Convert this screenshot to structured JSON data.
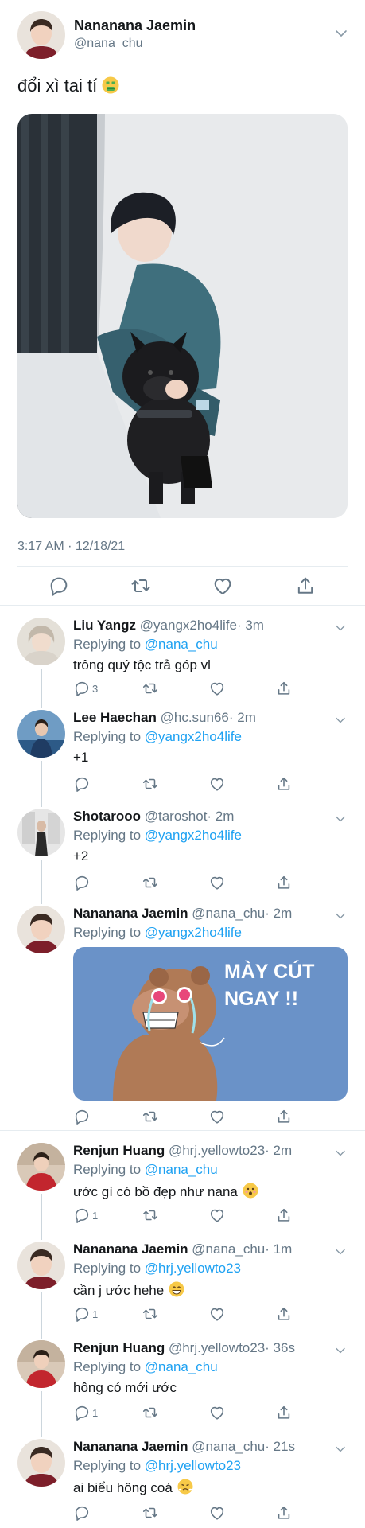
{
  "main_tweet": {
    "display_name": "Nananana Jaemin",
    "handle": "@nana_chu",
    "text": "đổi xì tai tí",
    "timestamp": "3:17 AM · 12/18/21",
    "actions": [
      "reply-icon",
      "retweet-icon",
      "like-icon",
      "share-icon"
    ]
  },
  "replies": [
    {
      "display_name": "Liu Yangz",
      "handle": "@yangx2ho4life",
      "time": "· 3m",
      "replying_prefix": "Replying to ",
      "replying_to": "@nana_chu",
      "text": "trông quý tộc trả góp vl",
      "reply_count": "3"
    },
    {
      "display_name": "Lee Haechan",
      "handle": "@hc.sun66",
      "time": "· 2m",
      "replying_prefix": "Replying to ",
      "replying_to": "@yangx2ho4life",
      "text": "+1",
      "reply_count": ""
    },
    {
      "display_name": "Shotarooo",
      "handle": "@taroshot",
      "time": "· 2m",
      "replying_prefix": "Replying to ",
      "replying_to": "@yangx2ho4life",
      "text": "+2",
      "reply_count": ""
    },
    {
      "display_name": "Nananana Jaemin",
      "handle": "@nana_chu",
      "time": "· 2m",
      "replying_prefix": "Replying to ",
      "replying_to": "@yangx2ho4life",
      "text": "",
      "reply_count": "",
      "meme_text_line1": "MÀY CÚT",
      "meme_text_line2": "NGAY !!"
    },
    {
      "display_name": "Renjun Huang",
      "handle": "@hrj.yellowto23",
      "time": "· 2m",
      "replying_prefix": "Replying to ",
      "replying_to": "@nana_chu",
      "text": "ước gì có bồ đẹp như nana",
      "reply_count": "1"
    },
    {
      "display_name": "Nananana Jaemin",
      "handle": "@nana_chu",
      "time": "· 1m",
      "replying_prefix": "Replying to ",
      "replying_to": "@hrj.yellowto23",
      "text": "cần j ước hehe",
      "reply_count": "1"
    },
    {
      "display_name": "Renjun Huang",
      "handle": "@hrj.yellowto23",
      "time": "· 36s",
      "replying_prefix": "Replying to ",
      "replying_to": "@nana_chu",
      "text": "hông có mới ước",
      "reply_count": "1"
    },
    {
      "display_name": "Nananana Jaemin",
      "handle": "@nana_chu",
      "time": "· 21s",
      "replying_prefix": "Replying to ",
      "replying_to": "@hrj.yellowto23",
      "text": "ai biểu hông coá",
      "reply_count": ""
    }
  ],
  "colors": {
    "link": "#1da1f2",
    "secondary_text": "#657786",
    "divider": "#e6ecf0",
    "meme_bg": "#6a92c8"
  }
}
